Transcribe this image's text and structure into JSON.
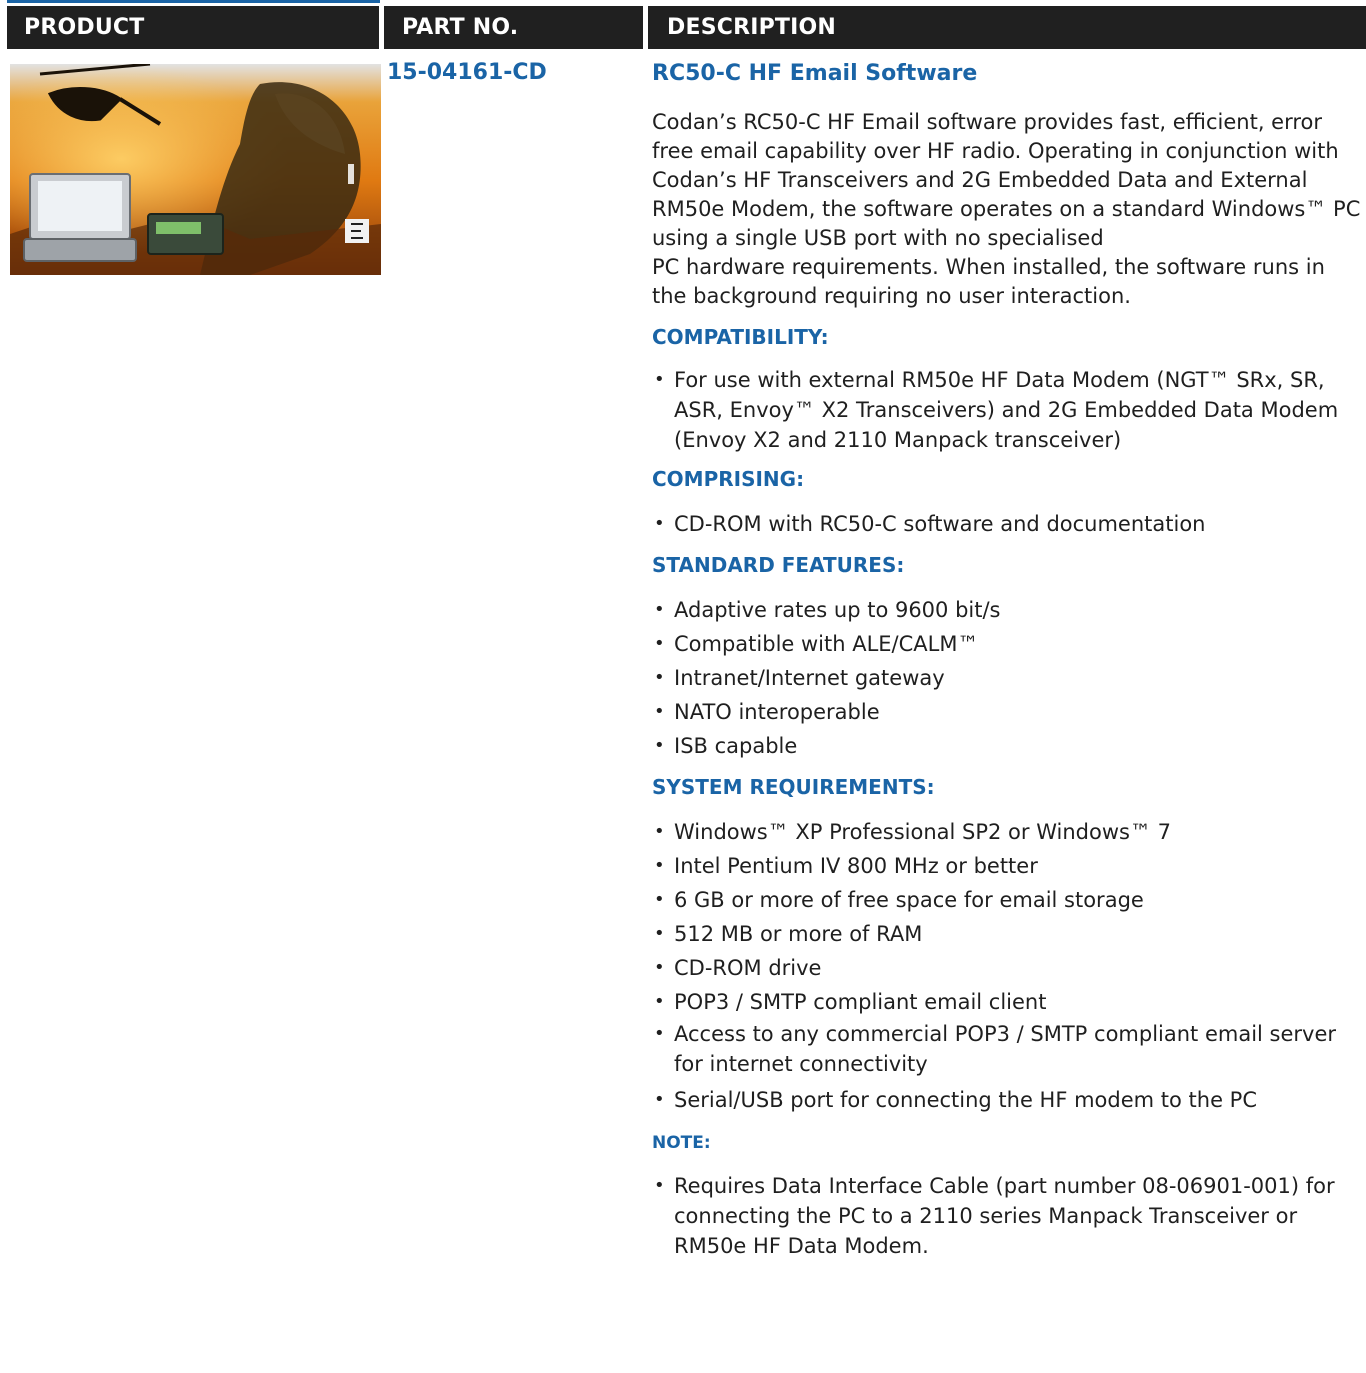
{
  "header": {
    "col_product": "PRODUCT",
    "col_part_no": "PART NO.",
    "col_description": "DESCRIPTION",
    "background_color": "#202020",
    "accent_color": "#1a64a6"
  },
  "product": {
    "part_no": "15-04161-CD",
    "title": "RC50-C HF Email Software",
    "description_lines": [
      "Codan’s RC50-C HF Email software provides fast, efficient, error free email capability over HF radio. Operating in conjunction with Codan’s HF Transceivers and 2G Embedded Data and External RM50e Modem, the software operates on a standard Windows™ PC using a single USB port with no specialised",
      "PC hardware requirements. When installed, the software runs in the background requiring no user interaction."
    ],
    "image_label": "RC50-C HF Email software product image"
  },
  "sections": [
    {
      "heading": "COMPATIBILITY:",
      "items": [
        "For use with external RM50e HF Data Modem (NGT™ SRx, SR, ASR, Envoy™ X2 Transceivers) and 2G Embedded Data Modem (Envoy X2 and 2110 Manpack transceiver)"
      ]
    },
    {
      "heading": "COMPRISING:",
      "items": [
        "CD-ROM with RC50-C software and documentation"
      ]
    },
    {
      "heading": "STANDARD FEATURES:",
      "items": [
        "Adaptive rates up to 9600 bit/s",
        "Compatible with ALE/CALM™",
        "Intranet/Internet gateway",
        "NATO interoperable",
        "ISB capable"
      ]
    },
    {
      "heading": "SYSTEM REQUIREMENTS:",
      "items": [
        "Windows™ XP Professional SP2 or Windows™ 7",
        "Intel Pentium IV 800 MHz or better",
        "6 GB or more of free space for email storage",
        "512 MB or more of RAM",
        "CD-ROM drive",
        "POP3 / SMTP compliant email client",
        "Access to any commercial POP3 / SMTP compliant email server for internet connectivity",
        "Serial/USB port for connecting the HF modem to the PC"
      ]
    },
    {
      "heading": "NOTE:",
      "items": [
        "Requires Data Interface Cable (part number 08-06901-001) for connecting the PC to a 2110 series Manpack Transceiver or RM50e HF Data Modem."
      ]
    }
  ]
}
